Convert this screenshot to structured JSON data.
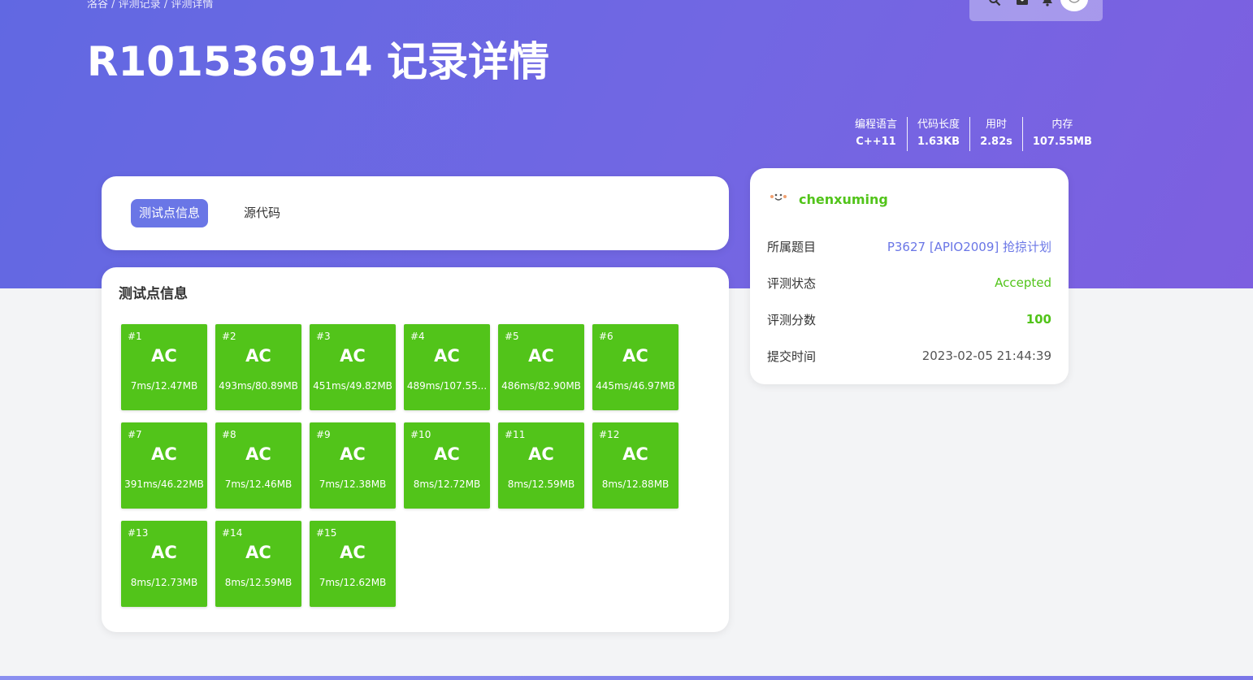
{
  "breadcrumb": [
    "洛谷",
    "评测记录",
    "评测详情"
  ],
  "breadcrumb_sep": " / ",
  "page_title": "R101536914 记录详情",
  "stats": [
    {
      "label": "编程语言",
      "value": "C++11"
    },
    {
      "label": "代码长度",
      "value": "1.63KB"
    },
    {
      "label": "用时",
      "value": "2.82s"
    },
    {
      "label": "内存",
      "value": "107.55MB"
    }
  ],
  "tabs": [
    {
      "label": "测试点信息",
      "active": true
    },
    {
      "label": "源代码",
      "active": false
    }
  ],
  "tests_title": "测试点信息",
  "testcases": [
    {
      "num": "#1",
      "status": "AC",
      "info": "7ms/12.47MB"
    },
    {
      "num": "#2",
      "status": "AC",
      "info": "493ms/80.89MB"
    },
    {
      "num": "#3",
      "status": "AC",
      "info": "451ms/49.82MB"
    },
    {
      "num": "#4",
      "status": "AC",
      "info": "489ms/107.55..."
    },
    {
      "num": "#5",
      "status": "AC",
      "info": "486ms/82.90MB"
    },
    {
      "num": "#6",
      "status": "AC",
      "info": "445ms/46.97MB"
    },
    {
      "num": "#7",
      "status": "AC",
      "info": "391ms/46.22MB"
    },
    {
      "num": "#8",
      "status": "AC",
      "info": "7ms/12.46MB"
    },
    {
      "num": "#9",
      "status": "AC",
      "info": "7ms/12.38MB"
    },
    {
      "num": "#10",
      "status": "AC",
      "info": "8ms/12.72MB"
    },
    {
      "num": "#11",
      "status": "AC",
      "info": "8ms/12.59MB"
    },
    {
      "num": "#12",
      "status": "AC",
      "info": "8ms/12.88MB"
    },
    {
      "num": "#13",
      "status": "AC",
      "info": "8ms/12.73MB"
    },
    {
      "num": "#14",
      "status": "AC",
      "info": "8ms/12.59MB"
    },
    {
      "num": "#15",
      "status": "AC",
      "info": "7ms/12.62MB"
    }
  ],
  "user": {
    "name": "chenxuming"
  },
  "info": {
    "problem_label": "所属题目",
    "problem_value": "P3627 [APIO2009] 抢掠计划",
    "status_label": "评测状态",
    "status_value": "Accepted",
    "score_label": "评测分数",
    "score_value": "100",
    "time_label": "提交时间",
    "time_value": "2023-02-05 21:44:39"
  },
  "colors": {
    "accent": "#6a76e6",
    "ac_green": "#52c41a",
    "hero_start": "#6168e2",
    "hero_end": "#7d5fe0"
  },
  "icons": [
    "search-icon",
    "mail-icon",
    "bell-icon",
    "avatar"
  ]
}
